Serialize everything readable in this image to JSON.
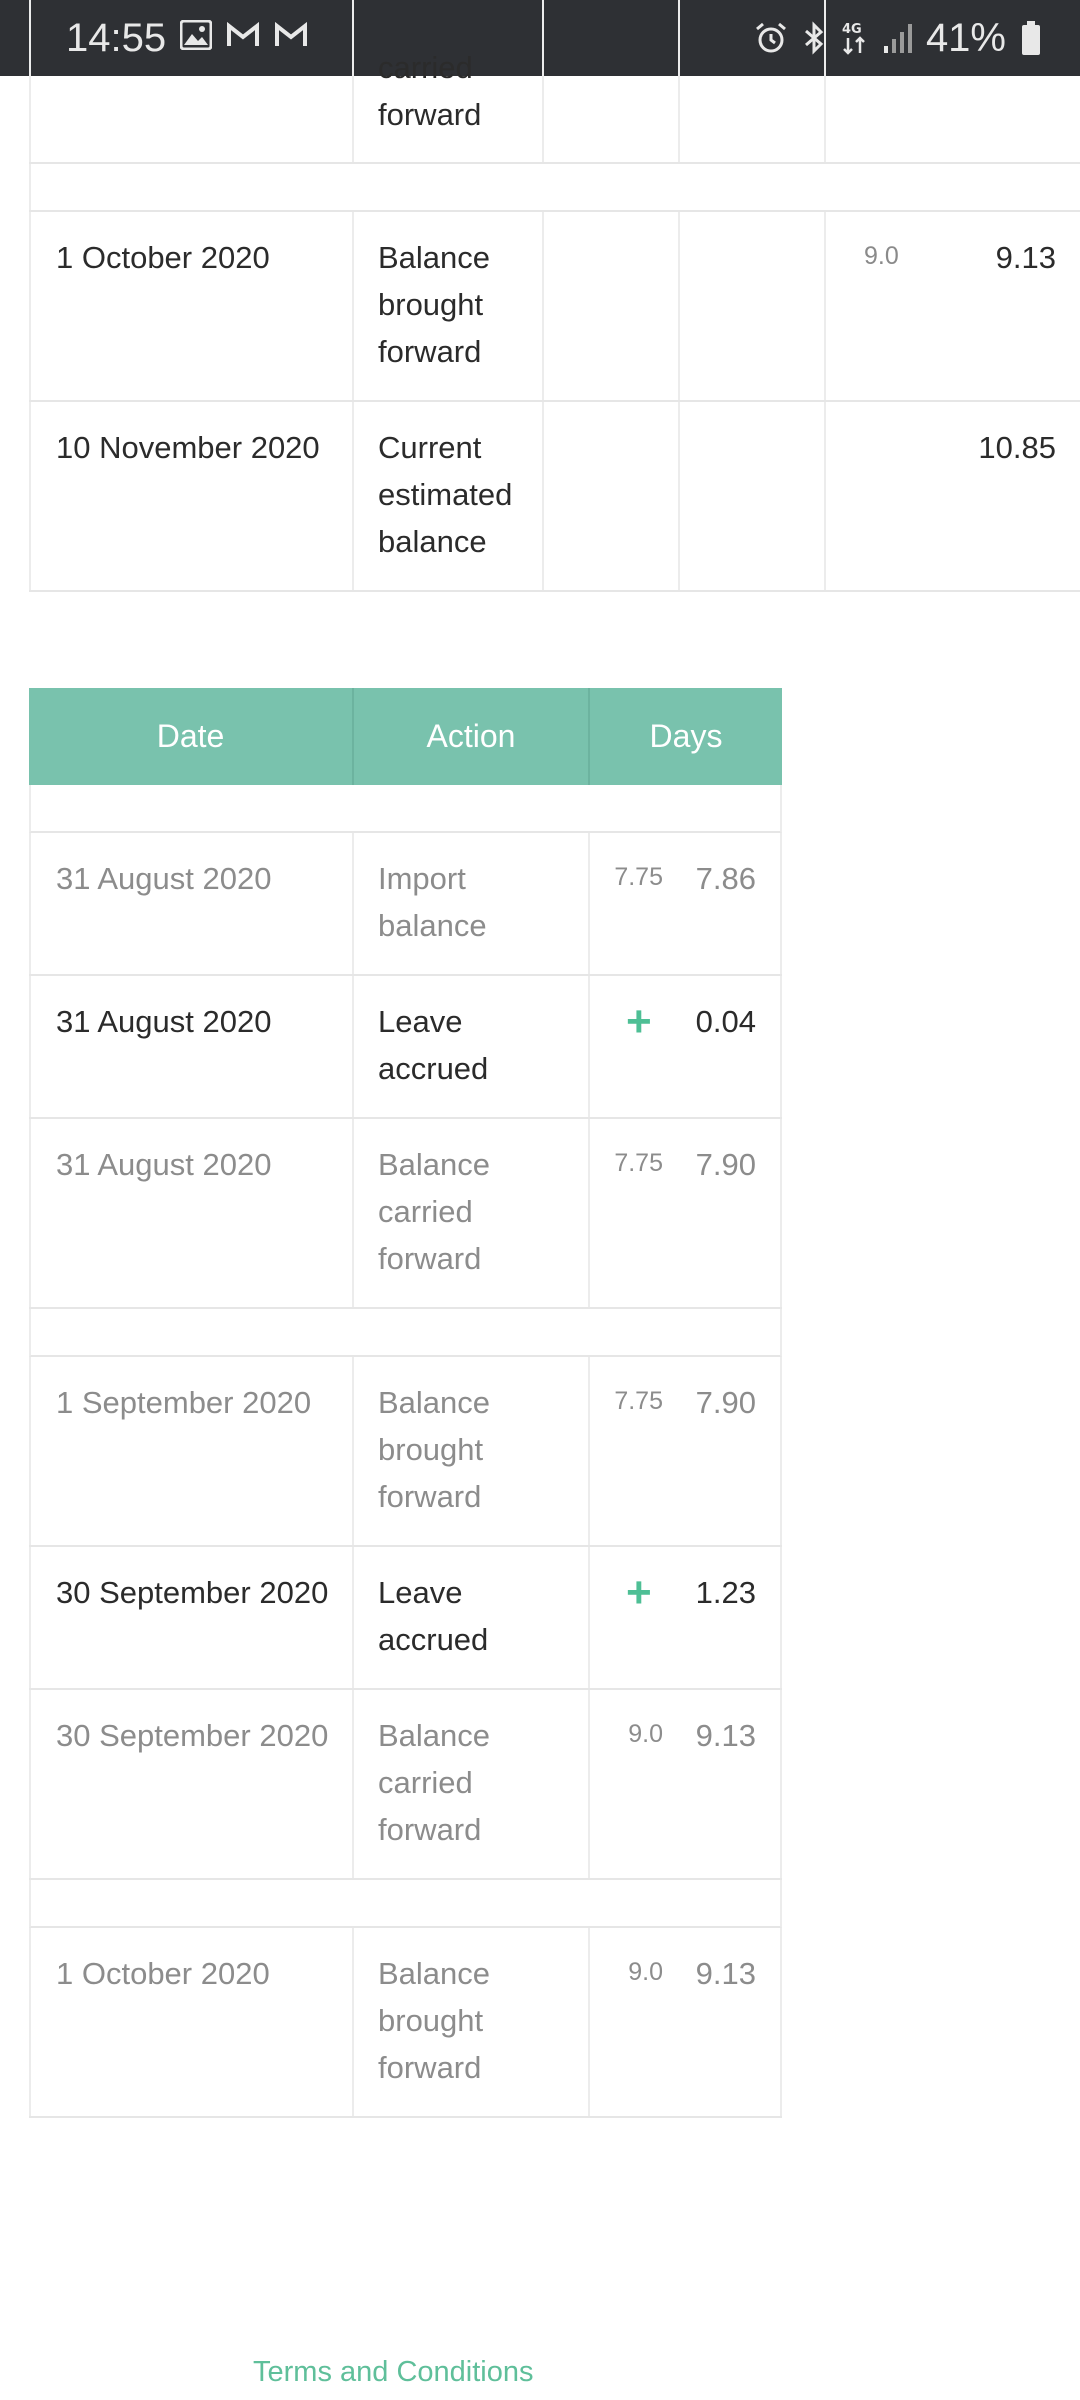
{
  "status_bar": {
    "time": "14:55",
    "battery": "41%",
    "network": "4G",
    "icons": [
      "image-icon",
      "gmail-icon",
      "gmail-icon",
      "alarm-icon",
      "bluetooth-icon",
      "network-4g-icon",
      "signal-icon",
      "battery-icon"
    ]
  },
  "upper_table": {
    "rows": [
      {
        "date": "",
        "action": "carried forward",
        "small": "",
        "value": ""
      },
      {
        "date": "1 October 2020",
        "action": "Balance brought forward",
        "small": "9.0",
        "value": "9.13"
      },
      {
        "date": "10 November 2020",
        "action": "Current estimated balance",
        "small": "",
        "value": "10.85"
      }
    ]
  },
  "main_table": {
    "headers": {
      "date": "Date",
      "action": "Action",
      "days": "Days"
    },
    "rows": [
      {
        "date": "31 August 2020",
        "action": "Import balance",
        "small": "7.75",
        "value": "7.86",
        "type": "balance"
      },
      {
        "date": "31 August 2020",
        "action": "Leave accrued",
        "small": "+",
        "value": "0.04",
        "type": "accrual"
      },
      {
        "date": "31 August 2020",
        "action": "Balance carried forward",
        "small": "7.75",
        "value": "7.90",
        "type": "balance"
      },
      {
        "date": "1 September 2020",
        "action": "Balance brought forward",
        "small": "7.75",
        "value": "7.90",
        "type": "balance"
      },
      {
        "date": "30 September 2020",
        "action": "Leave accrued",
        "small": "+",
        "value": "1.23",
        "type": "accrual"
      },
      {
        "date": "30 September 2020",
        "action": "Balance carried forward",
        "small": "9.0",
        "value": "9.13",
        "type": "balance"
      },
      {
        "date": "1 October 2020",
        "action": "Balance brought forward",
        "small": "9.0",
        "value": "9.13",
        "type": "balance"
      }
    ]
  },
  "footer": {
    "terms_link": "Terms and Conditions"
  },
  "colors": {
    "header_bg": "#79c2ad",
    "accent_green": "#4ebf95",
    "link": "#5fbf9a"
  }
}
